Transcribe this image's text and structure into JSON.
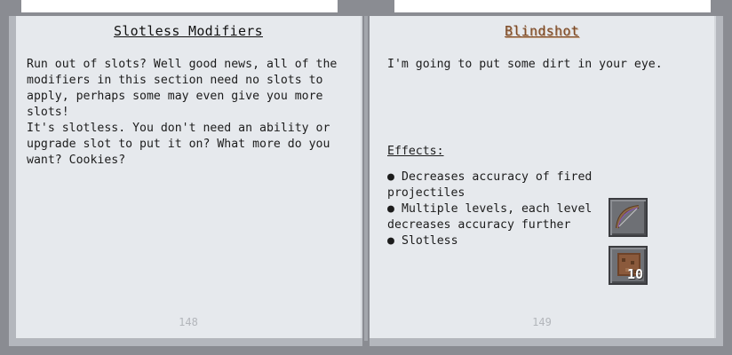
{
  "left_page": {
    "title": "Slotless Modifiers",
    "paragraph1": "Run out of slots? Well good news, all of the modifiers in this section need no slots to apply, perhaps some may even give you more slots!",
    "paragraph2": "It's slotless. You don't need an ability or upgrade slot to put it on? What more do you want? Cookies?",
    "page_number": "148"
  },
  "right_page": {
    "title": "Blindshot",
    "intro": "I'm going to put some dirt in your eye.",
    "effects_label": "Effects:",
    "effects": [
      "Decreases accuracy of fired projectiles",
      "Multiple levels, each level decreases accuracy further",
      "Slotless"
    ],
    "bullet": "●",
    "page_number": "149",
    "slots": [
      {
        "item": "bow-icon"
      },
      {
        "item": "dirt-block-icon",
        "count": "10"
      }
    ]
  },
  "colors": {
    "page": "#e6e9ed",
    "frame": "#8a8c92",
    "title_accent": "#7a4a2a"
  }
}
